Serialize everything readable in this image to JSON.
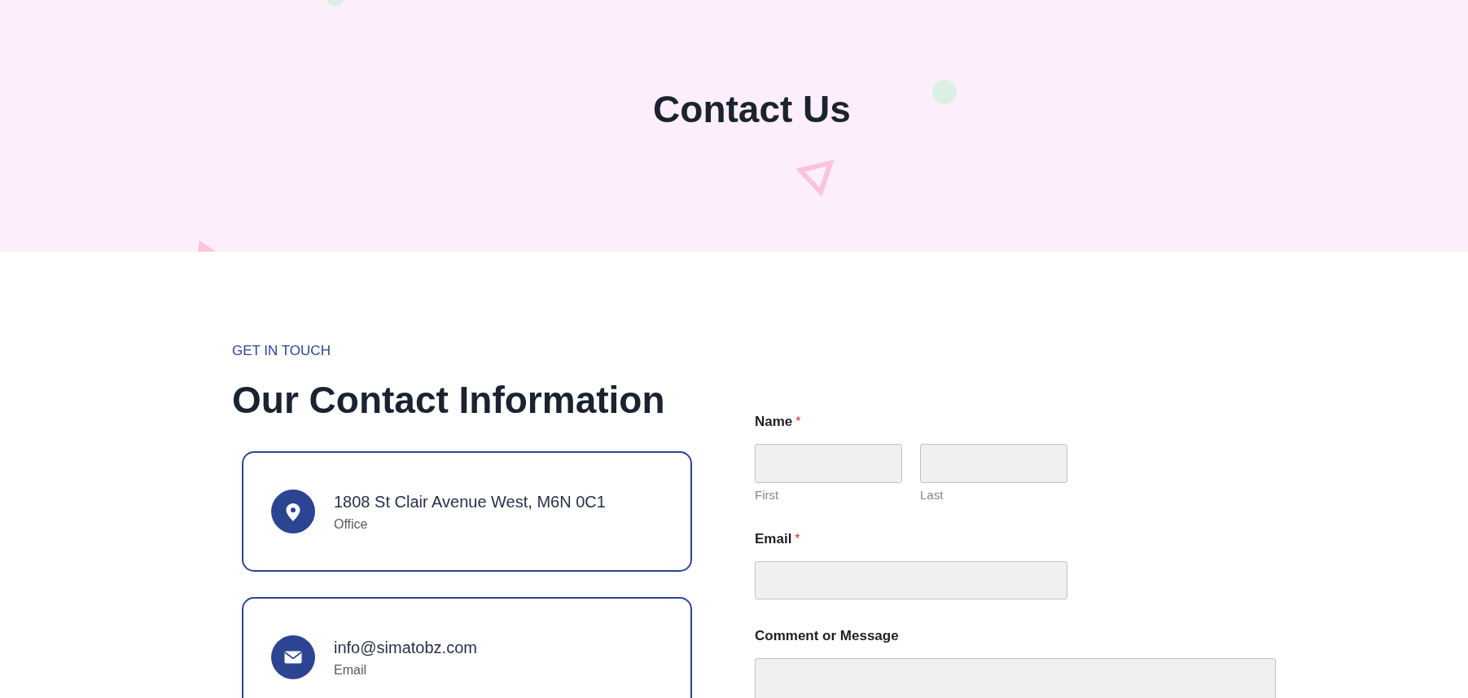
{
  "page_header": {
    "title": "Contact Us"
  },
  "contact_info": {
    "eyebrow": "GET IN TOUCH",
    "heading": "Our Contact Information",
    "items": [
      {
        "kind": "location",
        "value": "1808 St Clair Avenue West, M6N 0C1",
        "label": "Office"
      },
      {
        "kind": "email",
        "value": "info@simatobz.com",
        "label": "Email"
      }
    ]
  },
  "form": {
    "fields": [
      {
        "kind": "split",
        "label": "Name",
        "required_mark": "*",
        "subfields": [
          {
            "sublabel": "First"
          },
          {
            "sublabel": "Last"
          }
        ]
      },
      {
        "kind": "text",
        "label": "Email",
        "required_mark": "*"
      },
      {
        "kind": "textarea",
        "label": "Comment or Message"
      }
    ]
  }
}
